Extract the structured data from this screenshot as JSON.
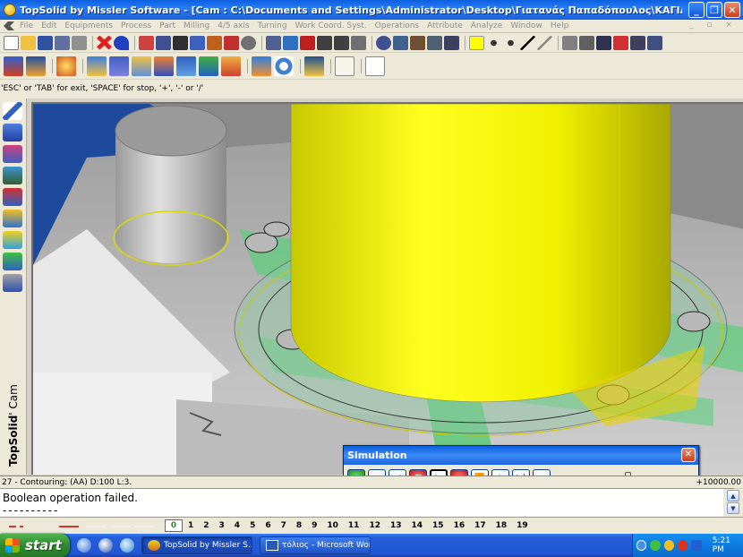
{
  "window": {
    "title": "TopSolid by Missler Software - [Cam : C:\\Documents and Settings\\Administrator\\Desktop\\Γιατανάς Παπαδόπουλος\\ΚΑΓΙΑΚΙ.cam * <<current>> (Assoc...",
    "minimize": "_",
    "maximize": "❐",
    "close": "✕"
  },
  "menu": {
    "items": [
      "File",
      "Edit",
      "Equipments",
      "Process",
      "Part",
      "Milling",
      "4/5 axis",
      "Turning",
      "Work Coord. Syst.",
      "Operations",
      "Attribute",
      "Analyze",
      "Window",
      "Help"
    ],
    "mdi_controls": "_ ▫ ×"
  },
  "hint": "'ESC' or 'TAB' for exit, 'SPACE' for stop, '+', '-' or '/'",
  "brand": {
    "top": "TopSolid",
    "sub": "' Cam"
  },
  "simulation": {
    "title": "Simulation",
    "close": "✕",
    "buttons": [
      {
        "name": "sim-home-button",
        "glyph": "⏏",
        "style": "green"
      },
      {
        "name": "sim-first-button",
        "glyph": "⏮",
        "style": ""
      },
      {
        "name": "sim-step-back-button",
        "glyph": "◀",
        "style": ""
      },
      {
        "name": "sim-stop-button",
        "glyph": "■",
        "style": "red"
      },
      {
        "name": "sim-play-button",
        "glyph": "▶",
        "style": "active"
      },
      {
        "name": "sim-pause-button",
        "glyph": "⏸",
        "style": "red"
      },
      {
        "name": "sim-fast-forward-button",
        "glyph": "⏩",
        "style": ""
      },
      {
        "name": "sim-step-forward-button",
        "glyph": "⏵",
        "style": ""
      },
      {
        "name": "sim-next-button",
        "glyph": "▶|",
        "style": ""
      },
      {
        "name": "sim-last-button",
        "glyph": "⏭",
        "style": ""
      }
    ],
    "speed": 0.52
  },
  "status": {
    "operation": "27 - Contouring:   (AA) D:100 L:3.",
    "coordinate": "+10000.00"
  },
  "messages": {
    "line1": "Boolean operation failed.",
    "line2": "----------"
  },
  "layers": {
    "current": "0",
    "numbers": [
      "1",
      "2",
      "3",
      "4",
      "5",
      "6",
      "7",
      "8",
      "9",
      "10",
      "11",
      "12",
      "13",
      "14",
      "15",
      "16",
      "17",
      "18",
      "19"
    ]
  },
  "taskbar": {
    "start": "start",
    "tasks": [
      {
        "label": "TopSolid by Missler S...",
        "active": true
      },
      {
        "label": "τόλιος - Microsoft Word",
        "active": false
      }
    ],
    "clock": "5:21 PM"
  },
  "colors": {
    "viewport_bg": "#234a9a",
    "tool_yellow": "#f4f400",
    "fixture_green": "#4ec86e",
    "stock_grey": "#c8c8c8"
  }
}
